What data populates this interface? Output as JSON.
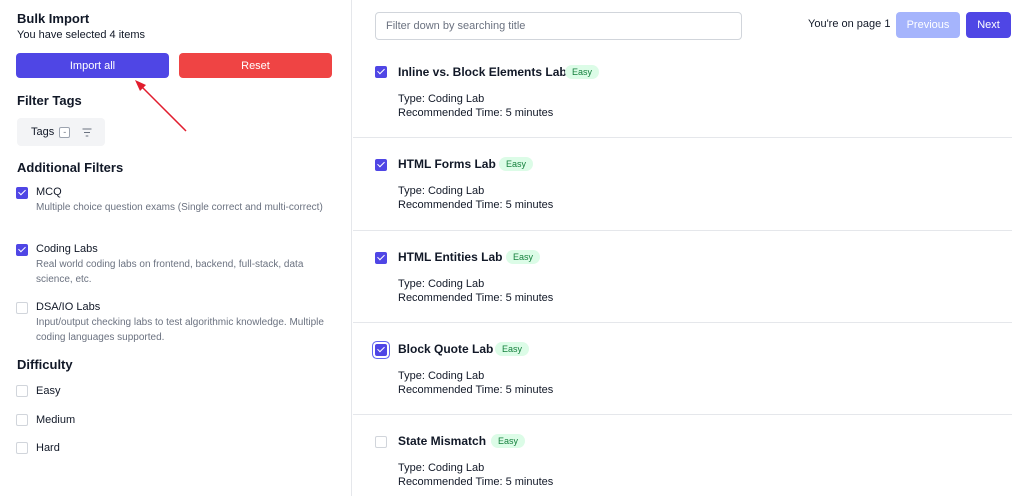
{
  "sidebar": {
    "title": "Bulk Import",
    "selected_text": "You have selected 4 items",
    "import_all_label": "Import all",
    "reset_label": "Reset",
    "filter_tags_title": "Filter Tags",
    "tags_label": "Tags",
    "tags_toggle": "-",
    "additional_filters_title": "Additional Filters",
    "filters": [
      {
        "label": "MCQ",
        "description": "Multiple choice question exams (Single correct and multi-correct)",
        "checked": true
      },
      {
        "label": "Coding Labs",
        "description": "Real world coding labs on frontend, backend, full-stack, data science, etc.",
        "checked": true
      },
      {
        "label": "DSA/IO Labs",
        "description": "Input/output checking labs to test algorithmic knowledge. Multiple coding languages supported.",
        "checked": false
      }
    ],
    "difficulty_title": "Difficulty",
    "difficulty": [
      {
        "label": "Easy",
        "checked": false
      },
      {
        "label": "Medium",
        "checked": false
      },
      {
        "label": "Hard",
        "checked": false
      }
    ]
  },
  "main": {
    "search_placeholder": "Filter down by searching title",
    "search_value": "",
    "page_info": "You're on page 1",
    "previous_label": "Previous",
    "next_label": "Next",
    "labs": [
      {
        "title": "Inline vs. Block Elements Lab",
        "badge": "Easy",
        "type": "Type: Coding Lab",
        "time": "Recommended Time: 5 minutes",
        "checked": true
      },
      {
        "title": "HTML Forms Lab",
        "badge": "Easy",
        "type": "Type: Coding Lab",
        "time": "Recommended Time: 5 minutes",
        "checked": true
      },
      {
        "title": "HTML Entities Lab",
        "badge": "Easy",
        "type": "Type: Coding Lab",
        "time": "Recommended Time: 5 minutes",
        "checked": true
      },
      {
        "title": "Block Quote Lab",
        "badge": "Easy",
        "type": "Type: Coding Lab",
        "time": "Recommended Time: 5 minutes",
        "checked": true
      },
      {
        "title": "State Mismatch",
        "badge": "Easy",
        "type": "Type: Coding Lab",
        "time": "Recommended Time: 5 minutes",
        "checked": false
      }
    ]
  },
  "colors": {
    "primary": "#4f46e5",
    "danger": "#ef4444",
    "disabled_primary": "#a5b4fc",
    "badge_bg": "#dcfce7",
    "badge_text": "#15803d",
    "annotation_arrow": "#e11d2e"
  }
}
